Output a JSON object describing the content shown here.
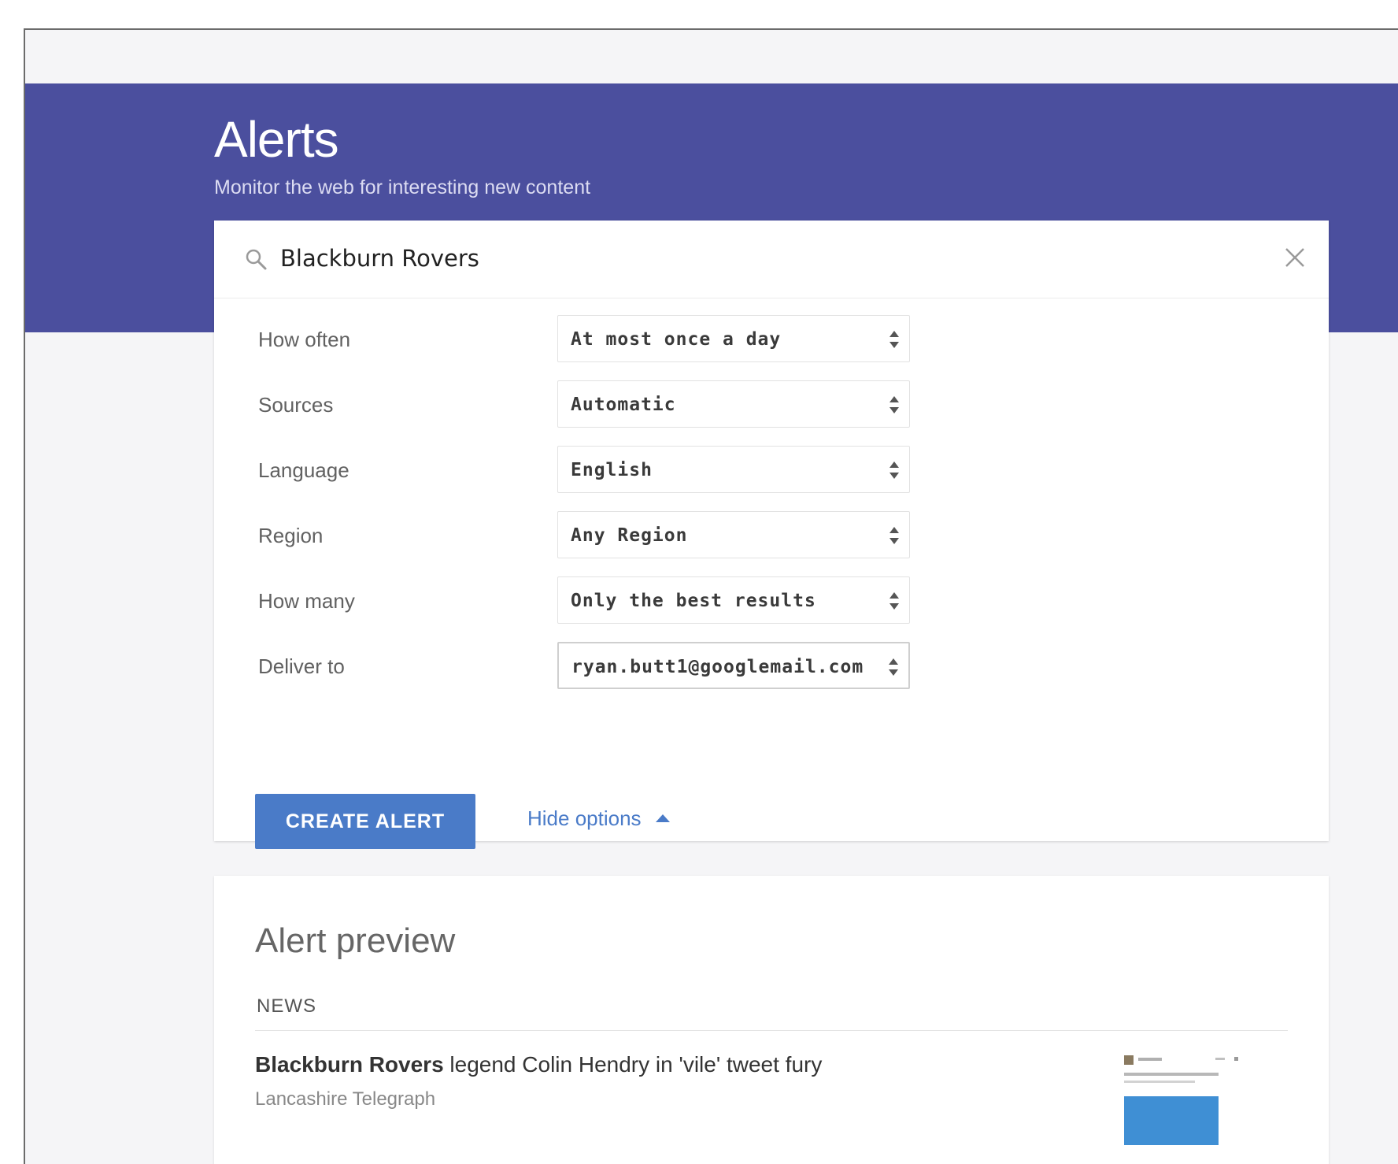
{
  "header": {
    "title": "Alerts",
    "subtitle": "Monitor the web for interesting new content"
  },
  "search": {
    "query": "Blackburn Rovers"
  },
  "options": [
    {
      "label": "How often",
      "value": "At most once a day"
    },
    {
      "label": "Sources",
      "value": "Automatic"
    },
    {
      "label": "Language",
      "value": "English"
    },
    {
      "label": "Region",
      "value": "Any Region"
    },
    {
      "label": "How many",
      "value": "Only the best results"
    },
    {
      "label": "Deliver to",
      "value": "ryan.butt1@googlemail.com"
    }
  ],
  "actions": {
    "create_label": "CREATE ALERT",
    "hide_options_label": "Hide options"
  },
  "preview": {
    "title": "Alert preview",
    "section": "NEWS",
    "items": [
      {
        "headline_bold": "Blackburn Rovers",
        "headline_rest": " legend Colin Hendry in 'vile' tweet fury",
        "source": "Lancashire Telegraph"
      }
    ]
  },
  "colors": {
    "banner": "#4b4f9e",
    "accent": "#4a7bc8",
    "background": "#f5f5f7"
  },
  "icons": [
    "search-icon",
    "close-icon",
    "updown-icon",
    "triangle-up-icon"
  ]
}
